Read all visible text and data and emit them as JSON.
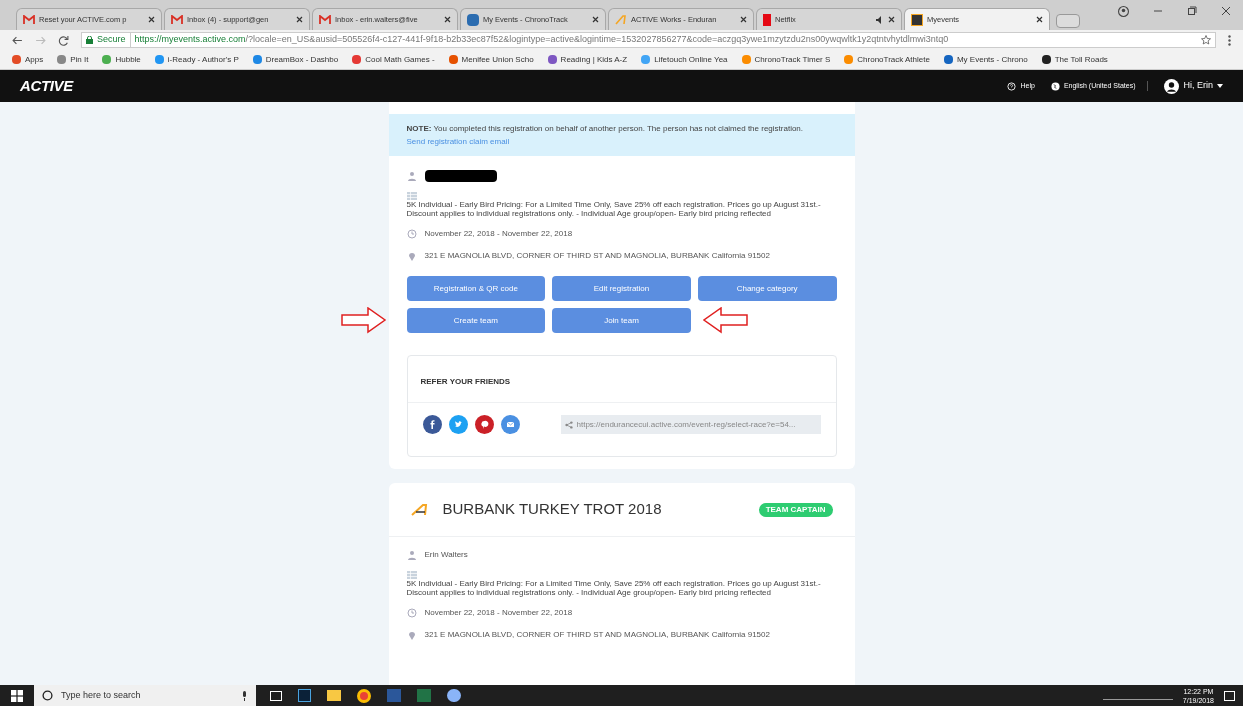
{
  "browser": {
    "tabs": [
      {
        "title": "Reset your ACTIVE.com p",
        "kind": "gmail",
        "selected": false,
        "muted": false
      },
      {
        "title": "Inbox (4) - support@gen",
        "kind": "gmail",
        "selected": false,
        "muted": false
      },
      {
        "title": "Inbox - erin.walters@five",
        "kind": "gmail",
        "selected": false,
        "muted": false
      },
      {
        "title": "My Events - ChronoTrack",
        "kind": "chrono",
        "selected": false,
        "muted": false
      },
      {
        "title": "ACTIVE Works - Enduran",
        "kind": "active",
        "selected": false,
        "muted": false
      },
      {
        "title": "Netflix",
        "kind": "netflix",
        "selected": false,
        "muted": true
      },
      {
        "title": "Myevents",
        "kind": "myevents",
        "selected": true,
        "muted": false
      }
    ],
    "secure_label": "Secure",
    "url_host": "https://myevents.active.com",
    "url_rest": "/?locale=en_US&ausid=505526f4-c127-441f-9f18-b2b33ec87f52&logintype=active&logintime=1532027856277&code=aczgq3ywe1mzytzdu2ns00ywqwltk1y2qtntvhytdlmwi3ntq0",
    "bookmarks": [
      {
        "label": "Apps",
        "color": "#e34c26"
      },
      {
        "label": "Pin It",
        "color": "#888888"
      },
      {
        "label": "Hubble",
        "color": "#4caf50"
      },
      {
        "label": "i-Ready - Author's P",
        "color": "#2196f3"
      },
      {
        "label": "DreamBox - Dashbo",
        "color": "#1e88e5"
      },
      {
        "label": "Cool Math Games -",
        "color": "#e53935"
      },
      {
        "label": "Menifee Union Scho",
        "color": "#e65100"
      },
      {
        "label": "Reading | Kids A-Z",
        "color": "#7e57c2"
      },
      {
        "label": "Lifetouch Online Yea",
        "color": "#42a5f5"
      },
      {
        "label": "ChronoTrack Timer S",
        "color": "#fb8c00"
      },
      {
        "label": "ChronoTrack Athlete",
        "color": "#fb8c00"
      },
      {
        "label": "My Events - Chrono",
        "color": "#1565c0"
      },
      {
        "label": "The Toll Roads",
        "color": "#222222"
      }
    ]
  },
  "site_header": {
    "logo": "ACTIVE",
    "help": "Help",
    "language": "English (United States)",
    "user": "Hi, Erin"
  },
  "registration_card": {
    "note_label": "NOTE:",
    "note_text": "You completed this registration on behalf of another person. The person has not claimed the registration.",
    "note_link": "Send registration claim email",
    "category": "5K Individual - Early Bird Pricing: For a Limited Time Only, Save 25% off each registration. Prices go up August 31st.- Discount applies to individual registrations only. - Individual Age group/open- Early bird pricing reflected",
    "dates": "November 22, 2018 - November 22, 2018",
    "address": "321 E MAGNOLIA BLVD, CORNER OF THIRD ST AND MAGNOLIA, BURBANK California 91502",
    "buttons": [
      {
        "label": "Registration & QR code",
        "annotated": false
      },
      {
        "label": "Edit registration",
        "annotated": false
      },
      {
        "label": "Change category",
        "annotated": false
      },
      {
        "label": "Create team",
        "annotated": true
      },
      {
        "label": "Join team",
        "annotated": true
      }
    ],
    "refer_title": "REFER YOUR FRIENDS",
    "share_buttons": [
      {
        "kind": "facebook",
        "color": "#3b5998"
      },
      {
        "kind": "twitter",
        "color": "#1da1f2"
      },
      {
        "kind": "pinterest",
        "color": "#cb2027"
      },
      {
        "kind": "email",
        "color": "#4a90e2"
      }
    ],
    "share_link": "https://endurancecui.active.com/event-reg/select-race?e=54..."
  },
  "event_card": {
    "title": "BURBANK TURKEY TROT 2018",
    "badge": "TEAM CAPTAIN",
    "participant": "Erin Walters",
    "category": "5K Individual - Early Bird Pricing: For a Limited Time Only, Save 25% off each registration. Prices go up August 31st.- Discount applies to individual registrations only. - Individual Age group/open- Early bird pricing reflected",
    "dates": "November 22, 2018 - November 22, 2018",
    "address": "321 E MAGNOLIA BLVD, CORNER OF THIRD ST AND MAGNOLIA, BURBANK California 91502"
  },
  "taskbar": {
    "search_placeholder": "Type here to search",
    "time": "12:22 PM",
    "date": "7/19/2018"
  }
}
